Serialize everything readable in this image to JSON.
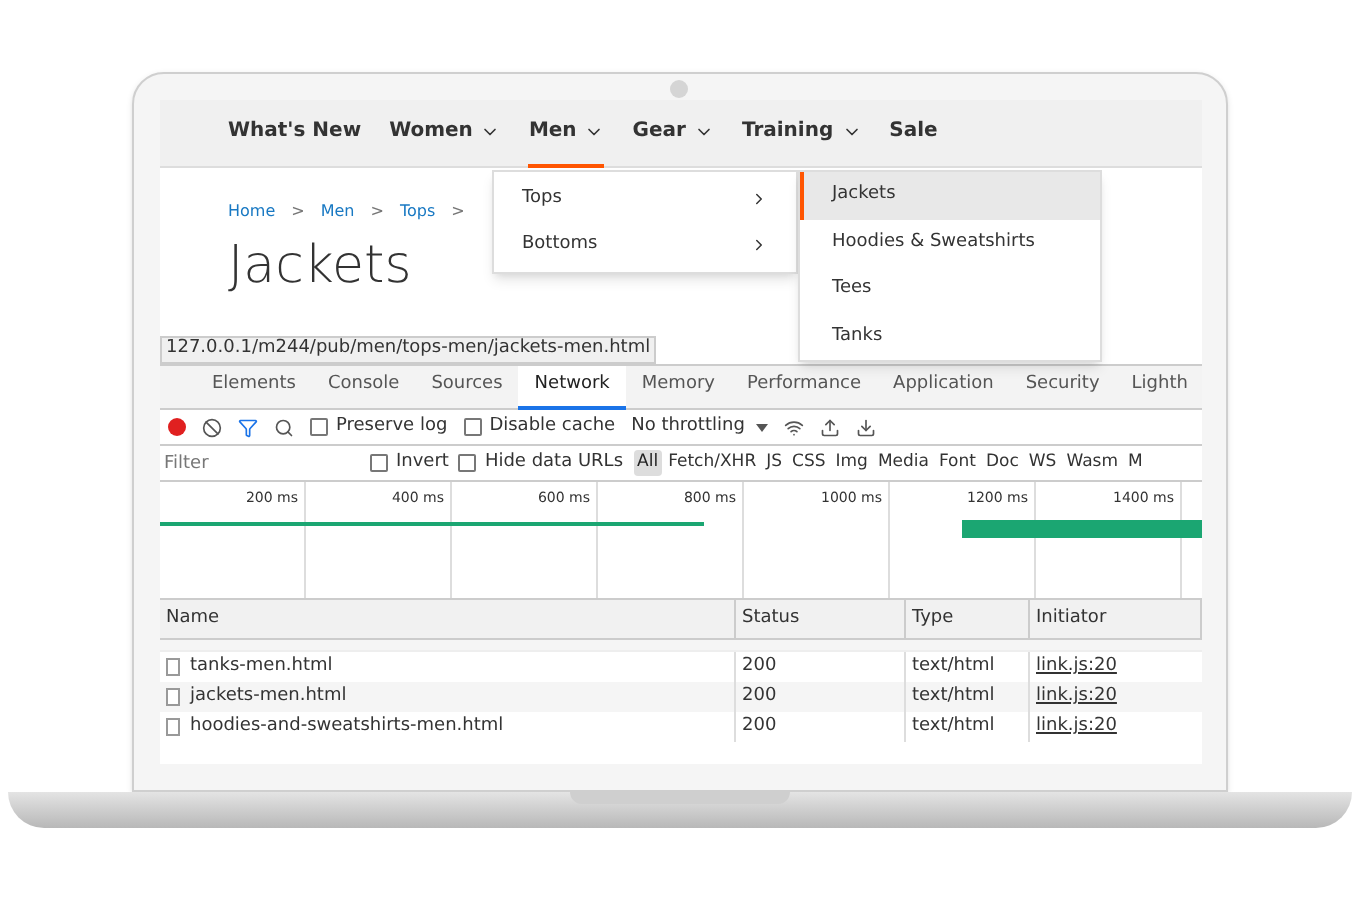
{
  "nav": {
    "items": [
      {
        "label": "What's New",
        "has_menu": false,
        "selected": false
      },
      {
        "label": "Women",
        "has_menu": true,
        "selected": false
      },
      {
        "label": "Men",
        "has_menu": true,
        "selected": true
      },
      {
        "label": "Gear",
        "has_menu": true,
        "selected": false
      },
      {
        "label": "Training",
        "has_menu": true,
        "selected": false
      },
      {
        "label": "Sale",
        "has_menu": false,
        "selected": false
      }
    ]
  },
  "breadcrumb": [
    "Home",
    "Men",
    "Tops"
  ],
  "separator": ">",
  "page_title": "Jackets",
  "menu": {
    "items": [
      {
        "label": "Tops"
      },
      {
        "label": "Bottoms"
      }
    ]
  },
  "submenu": {
    "items": [
      {
        "label": "Jackets",
        "selected": true
      },
      {
        "label": "Hoodies & Sweatshirts",
        "selected": false
      },
      {
        "label": "Tees",
        "selected": false
      },
      {
        "label": "Tanks",
        "selected": false
      }
    ]
  },
  "status_url": "127.0.0.1/m244/pub/men/tops-men/jackets-men.html",
  "devtools": {
    "tabs": [
      {
        "label": "Elements",
        "selected": false
      },
      {
        "label": "Console",
        "selected": false
      },
      {
        "label": "Sources",
        "selected": false
      },
      {
        "label": "Network",
        "selected": true
      },
      {
        "label": "Memory",
        "selected": false
      },
      {
        "label": "Performance",
        "selected": false
      },
      {
        "label": "Application",
        "selected": false
      },
      {
        "label": "Security",
        "selected": false
      },
      {
        "label": "Lighth",
        "selected": false
      }
    ],
    "recording": true,
    "preserve_log": {
      "label": "Preserve log",
      "checked": false
    },
    "disable_cache": {
      "label": "Disable cache",
      "checked": false
    },
    "throttling": "No throttling",
    "filter_placeholder": "Filter",
    "invert": {
      "label": "Invert",
      "checked": false
    },
    "hide_data_urls": {
      "label": "Hide data URLs",
      "checked": false
    },
    "types": [
      {
        "label": "All",
        "selected": true
      },
      {
        "label": "Fetch/XHR",
        "selected": false
      },
      {
        "label": "JS",
        "selected": false
      },
      {
        "label": "CSS",
        "selected": false
      },
      {
        "label": "Img",
        "selected": false
      },
      {
        "label": "Media",
        "selected": false
      },
      {
        "label": "Font",
        "selected": false
      },
      {
        "label": "Doc",
        "selected": false
      },
      {
        "label": "WS",
        "selected": false
      },
      {
        "label": "Wasm",
        "selected": false
      },
      {
        "label": "M",
        "selected": false
      }
    ],
    "timeline_ticks": [
      "200 ms",
      "400 ms",
      "600 ms",
      "800 ms",
      "1000 ms",
      "1200 ms",
      "1400 ms"
    ],
    "table": {
      "columns": [
        "Name",
        "Status",
        "Type",
        "Initiator"
      ],
      "rows": [
        {
          "name": "tanks-men.html",
          "status": "200",
          "type": "text/html",
          "initiator": "link.js:20"
        },
        {
          "name": "jackets-men.html",
          "status": "200",
          "type": "text/html",
          "initiator": "link.js:20"
        },
        {
          "name": "hoodies-and-sweatshirts-men.html",
          "status": "200",
          "type": "text/html",
          "initiator": "link.js:20"
        }
      ]
    }
  }
}
